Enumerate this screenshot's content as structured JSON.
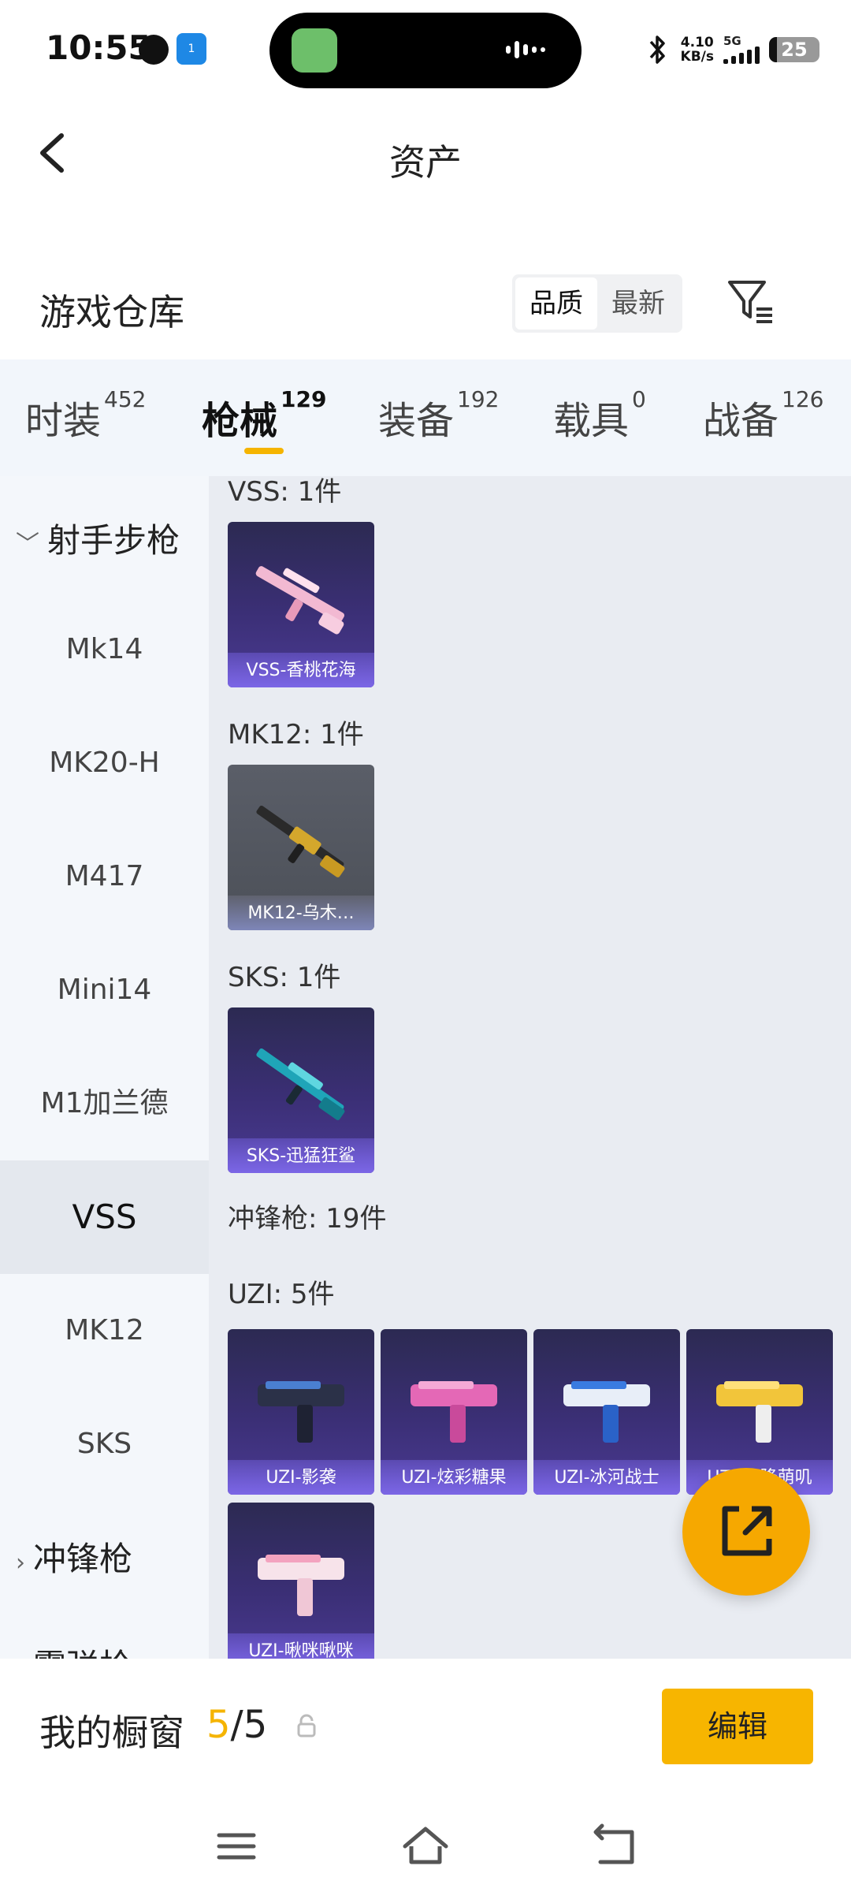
{
  "status_bar": {
    "time": "10:55",
    "net_speed_value": "4.10",
    "net_speed_unit": "KB/s",
    "network_type": "5G",
    "battery": "25",
    "nfc_badge": "1"
  },
  "header": {
    "title": "资产"
  },
  "warehouse": {
    "title": "游戏仓库",
    "sort_options": [
      "品质",
      "最新"
    ]
  },
  "tabs": [
    {
      "label": "时装",
      "count": "452"
    },
    {
      "label": "枪械",
      "count": "129"
    },
    {
      "label": "装备",
      "count": "192"
    },
    {
      "label": "载具",
      "count": "0"
    },
    {
      "label": "战备",
      "count": "126"
    }
  ],
  "sidebar": {
    "group_marksman": "射手步枪",
    "items": [
      "Mk14",
      "MK20-H",
      "M417",
      "Mini14",
      "M1加兰德",
      "VSS",
      "MK12",
      "SKS"
    ],
    "group_smg": "冲锋枪",
    "group_next_partial": "霰弹枪"
  },
  "content": {
    "vss_label": "VSS: 1件",
    "vss_item": "VSS-香桃花海",
    "mk12_label": "MK12: 1件",
    "mk12_item": "MK12-乌木…",
    "sks_label": "SKS: 1件",
    "sks_item": "SKS-迅猛狂鲨",
    "smg_label": "冲锋枪: 19件",
    "uzi_label": "UZI: 5件",
    "uzi_items": [
      "UZI-影袭",
      "UZI-炫彩糖果",
      "UZI-冰河战士",
      "UZI-天降萌叽",
      "UZI-啾咪啾咪"
    ]
  },
  "showcase": {
    "title": "我的橱窗",
    "current": "5",
    "total": "/5",
    "edit_label": "编辑"
  },
  "colors": {
    "accent": "#f5b400",
    "card_purple": "#3b2f76",
    "fab": "#f6a800"
  },
  "icons": [
    "back-arrow-icon",
    "filter-icon",
    "share-external-icon",
    "lock-icon",
    "menu-icon",
    "home-icon",
    "back-nav-icon"
  ]
}
